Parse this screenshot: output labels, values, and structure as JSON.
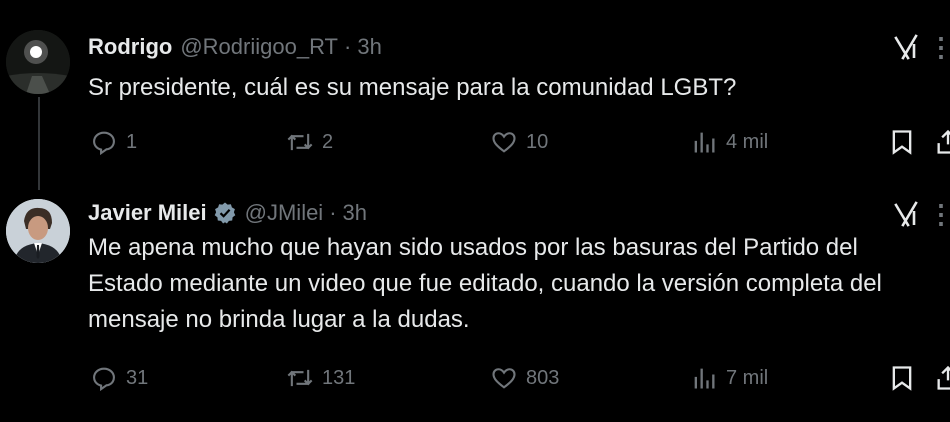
{
  "tweets": [
    {
      "author": "Rodrigo",
      "handle": "@Rodriigoo_RT",
      "separator": "·",
      "time": "3h",
      "verified": false,
      "text_lines": [
        "Sr presidente, cuál es su mensaje para la comunidad LGBT?"
      ],
      "stats": {
        "replies": "1",
        "retweets": "2",
        "likes": "10",
        "views": "4 mil"
      }
    },
    {
      "author": "Javier Milei",
      "handle": "@JMilei",
      "separator": "·",
      "time": "3h",
      "verified": true,
      "text_lines": [
        "Me apena mucho que hayan sido usados por las basuras del Partido del",
        "Estado mediante un video que fue editado, cuando la versión completa del",
        "mensaje no brinda lugar a la dudas."
      ],
      "stats": {
        "replies": "31",
        "retweets": "131",
        "likes": "803",
        "views": "7 mil"
      }
    }
  ],
  "icons": {
    "reply": "reply-icon",
    "retweet": "retweet-icon",
    "like": "heart-icon",
    "views": "views-icon",
    "bookmark": "bookmark-icon",
    "share": "share-icon",
    "grok": "grok-icon",
    "more": "more-icon",
    "verified": "verified-badge-icon"
  },
  "colors": {
    "background": "#000000",
    "text": "#e7e9ea",
    "muted": "#71767b",
    "verified": "#829aab",
    "thread_line": "#333639"
  }
}
